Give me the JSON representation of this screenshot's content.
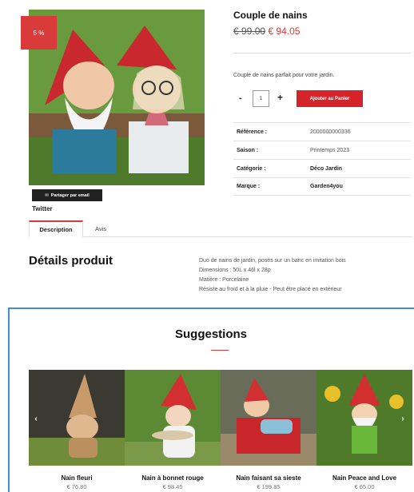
{
  "product": {
    "discount_badge": "5 %",
    "title": "Couple de nains",
    "old_price": "€ 99.00",
    "new_price": "€ 94.05",
    "short_description": "Couple de nains parfait pour votre jardin.",
    "quantity": "1",
    "add_to_cart_label": "Ajouter au Panier",
    "share_email_label": "Partager par email",
    "twitter_label": "Twitter",
    "attributes": [
      {
        "label": "Référence :",
        "value": "2000000000336"
      },
      {
        "label": "Saison :",
        "value": "Printemps 2023"
      },
      {
        "label": "Catégorie :",
        "value": "Déco Jardin"
      },
      {
        "label": "Marque :",
        "value": "Garden4you"
      }
    ]
  },
  "tabs": [
    {
      "label": "Description",
      "active": true
    },
    {
      "label": "Avis",
      "active": false
    }
  ],
  "details": {
    "title": "Détails produit",
    "lines": [
      "Duo de nains de jardin, posés sur un banc en imitation bois",
      "Dimensions : 50L x 46l x 28p",
      "Matière : Porcelaine",
      "Résiste au froid et à la pluie - Peut être placé en extérieur"
    ]
  },
  "suggestions": {
    "title": "Suggestions",
    "items": [
      {
        "name": "Nain fleuri",
        "price": "€ 76.80"
      },
      {
        "name": "Nain à bonnet rouge",
        "price": "€ 98.45"
      },
      {
        "name": "Nain faisant sa sieste",
        "price": "€ 199.85"
      },
      {
        "name": "Nain Peace and Love",
        "price": "€ 65.00"
      }
    ],
    "prev_arrow": "‹",
    "next_arrow": "›"
  },
  "colors": {
    "accent": "#d9383a",
    "button": "#d4242a",
    "frame": "#3d8fd8"
  }
}
